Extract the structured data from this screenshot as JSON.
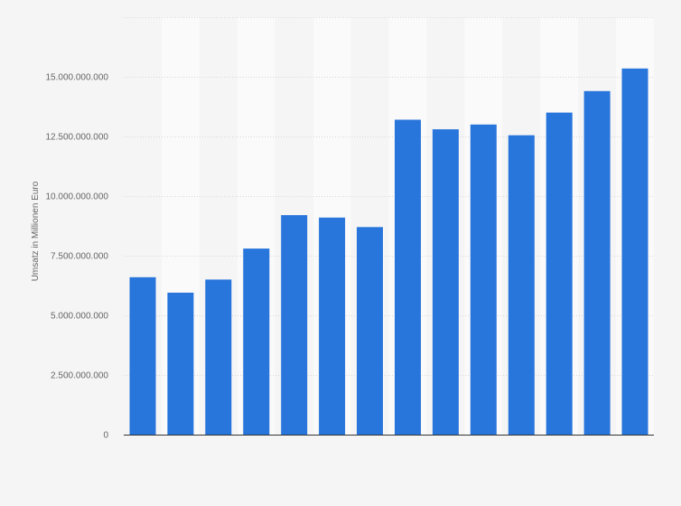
{
  "chart_data": {
    "type": "bar",
    "title": "",
    "xlabel": "",
    "ylabel": "Umsatz in Millionen Euro",
    "categories": [],
    "values": [
      6600000000,
      5950000000,
      6500000000,
      7800000000,
      9200000000,
      9100000000,
      8700000000,
      13200000000,
      12800000000,
      13000000000,
      12550000000,
      13500000000,
      14400000000,
      15350000000
    ],
    "ylim": [
      0,
      17500000000
    ],
    "yticks": [
      {
        "value": 0,
        "label": "0"
      },
      {
        "value": 2500000000,
        "label": "2.500.000.000"
      },
      {
        "value": 5000000000,
        "label": "5.000.000.000"
      },
      {
        "value": 7500000000,
        "label": "7.500.000.000"
      },
      {
        "value": 10000000000,
        "label": "10.000.000.000"
      },
      {
        "value": 12500000000,
        "label": "12.500.000.000"
      },
      {
        "value": 15000000000,
        "label": "15.000.000.000"
      }
    ],
    "grid": true,
    "legend": "none",
    "colors": {
      "bar": "#2875dc",
      "grid": "#d9d9d9",
      "axis": "#333333",
      "band": "#fafafa",
      "background": "#f5f5f5"
    }
  }
}
